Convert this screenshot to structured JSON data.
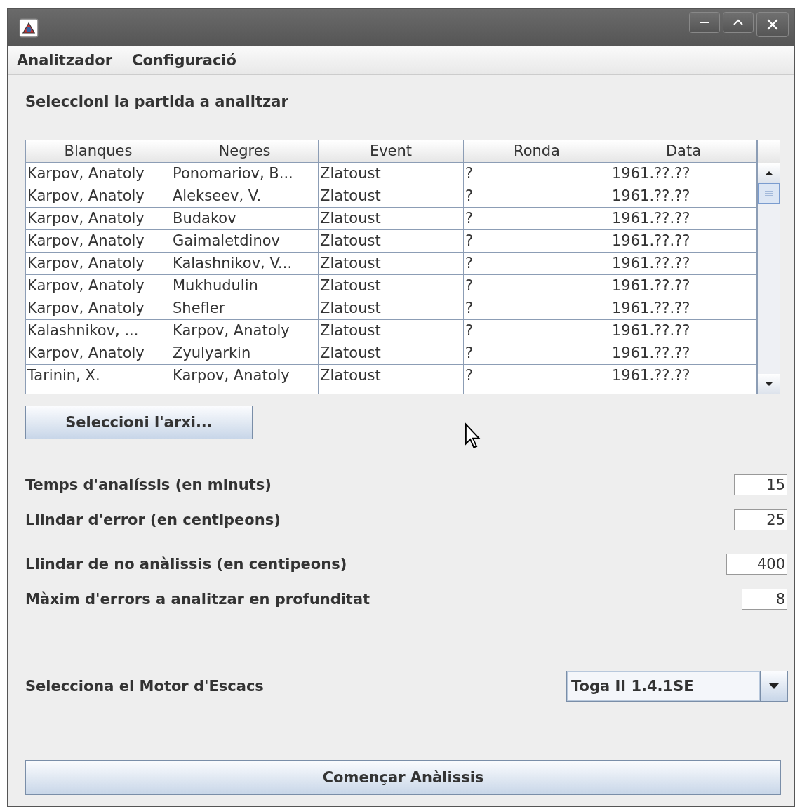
{
  "menu": [
    {
      "label": "Analitzador"
    },
    {
      "label": "Configuració"
    }
  ],
  "heading": "Seleccioni la partida a analitzar",
  "table": {
    "columns": [
      "Blanques",
      "Negres",
      "Event",
      "Ronda",
      "Data"
    ],
    "rows": [
      [
        "Karpov, Anatoly",
        "Ponomariov, B...",
        "Zlatoust",
        "?",
        "1961.??.??"
      ],
      [
        "Karpov, Anatoly",
        "Alekseev, V.",
        "Zlatoust",
        "?",
        "1961.??.??"
      ],
      [
        "Karpov, Anatoly",
        "Budakov",
        "Zlatoust",
        "?",
        "1961.??.??"
      ],
      [
        "Karpov, Anatoly",
        "Gaimaletdinov",
        "Zlatoust",
        "?",
        "1961.??.??"
      ],
      [
        "Karpov, Anatoly",
        "Kalashnikov, V...",
        "Zlatoust",
        "?",
        "1961.??.??"
      ],
      [
        "Karpov, Anatoly",
        "Mukhudulin",
        "Zlatoust",
        "?",
        "1961.??.??"
      ],
      [
        "Karpov, Anatoly",
        "Shefler",
        "Zlatoust",
        "?",
        "1961.??.??"
      ],
      [
        "Kalashnikov, ...",
        "Karpov, Anatoly",
        "Zlatoust",
        "?",
        "1961.??.??"
      ],
      [
        "Karpov, Anatoly",
        "Zyulyarkin",
        "Zlatoust",
        "?",
        "1961.??.??"
      ],
      [
        "Tarinin, X.",
        "Karpov, Anatoly",
        "Zlatoust",
        "?",
        "1961.??.??"
      ]
    ]
  },
  "file_button": "Seleccioni l'arxi...",
  "settings": [
    {
      "label": "Temps d'analíssis (en minuts)",
      "value": "15"
    },
    {
      "label": "Llindar d'error (en centipeons)",
      "value": "25"
    },
    {
      "label": "Llindar de no anàlissis (en centipeons)",
      "value": "400"
    },
    {
      "label": "Màxim d'errors a analitzar en profunditat",
      "value": "8"
    }
  ],
  "engine": {
    "label": "Selecciona el Motor d'Escacs",
    "value": "Toga II 1.4.1SE"
  },
  "start_button": "Començar Anàlissis"
}
